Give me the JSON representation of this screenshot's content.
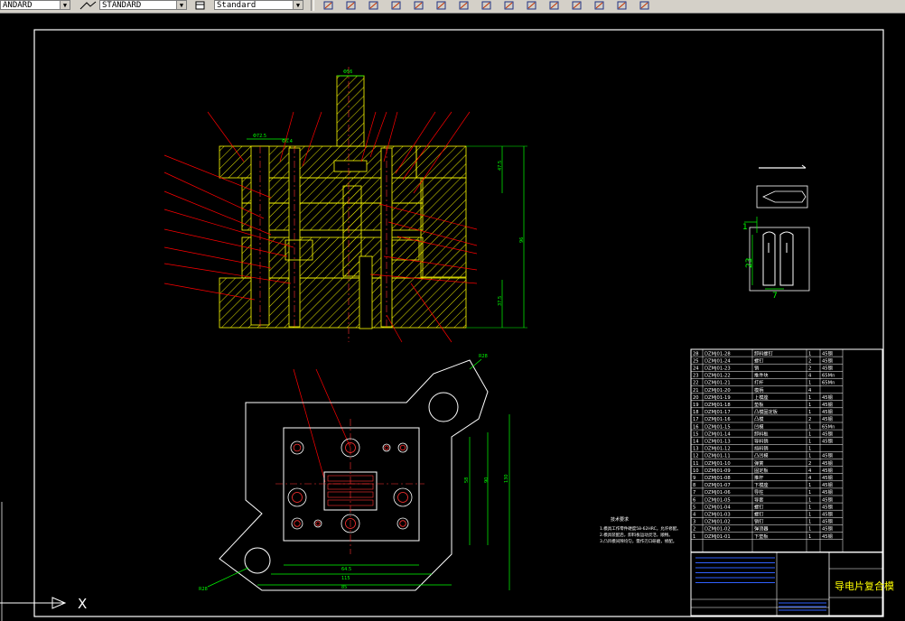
{
  "toolbar": {
    "text_style_combo": "ANDARD",
    "dim_style_combo": "STANDARD",
    "table_style_combo": "Standard",
    "icons": [
      "sketch-icon",
      "move-icon",
      "mirror-icon",
      "offset-icon",
      "array-icon",
      "pan-icon",
      "rotate-icon",
      "scale-icon",
      "stretch-icon",
      "trim-icon",
      "extend-icon",
      "break-icon",
      "chamfer-icon",
      "fillet-icon",
      "explode-icon"
    ]
  },
  "drawing": {
    "title": "导电片复合模",
    "notes_title": "技术要求",
    "notes": [
      "1.模具工作零件硬度58-62HRC，允许修配。",
      "2.模具装配后，卸料板运动灵活，顺畅。",
      "3.凸凹模间隙均匀，需作刃口研磨，修配。"
    ],
    "part_dims": {
      "width": "1",
      "height": "23",
      "pitch": "7"
    },
    "dims": {
      "top_width": "Φ56",
      "left_top": "Φ72.5",
      "left_mid": "Φ6.4",
      "right_total": "96",
      "right_top": "47.5",
      "right_bottom": "37.5",
      "plan_h1": "90",
      "plan_h2": "58",
      "plan_h3": "130",
      "plan_w1": "64.5",
      "plan_w2": "115",
      "plan_w3": "85",
      "hole_label_a": "R28",
      "hole_label_b": "R28"
    },
    "axis_label": "X",
    "bom_rows": [
      [
        "28",
        "DZMJ01-28",
        "卸料螺钉",
        "1",
        "45钢"
      ],
      [
        "25",
        "DZMJ01-24",
        "螺钉",
        "2",
        "45钢"
      ],
      [
        "24",
        "DZMJ01-23",
        "销",
        "2",
        "45钢"
      ],
      [
        "23",
        "DZMJ01-22",
        "推件块",
        "4",
        "65Mn"
      ],
      [
        "22",
        "DZMJ01-21",
        "打杆",
        "1",
        "65Mn"
      ],
      [
        "21",
        "DZMJ01-20",
        "模柄",
        "4",
        ""
      ],
      [
        "20",
        "DZMJ01-19",
        "上模座",
        "1",
        "45钢"
      ],
      [
        "19",
        "DZMJ01-18",
        "垫板",
        "1",
        "45钢"
      ],
      [
        "18",
        "DZMJ01-17",
        "凸模固定板",
        "1",
        "45钢"
      ],
      [
        "17",
        "DZMJ01-16",
        "凸模",
        "2",
        "45钢"
      ],
      [
        "16",
        "DZMJ01-15",
        "凹模",
        "1",
        "65Mn"
      ],
      [
        "15",
        "DZMJ01-14",
        "卸料板",
        "1",
        "45钢"
      ],
      [
        "14",
        "DZMJ01-13",
        "导料销",
        "1",
        "45钢"
      ],
      [
        "13",
        "DZMJ01-12",
        "挡料销",
        "1",
        ""
      ],
      [
        "12",
        "DZMJ01-11",
        "凸凹模",
        "1",
        "45钢"
      ],
      [
        "11",
        "DZMJ01-10",
        "弹簧",
        "2",
        "45钢"
      ],
      [
        "10",
        "DZMJ01-09",
        "固定板",
        "4",
        "45钢"
      ],
      [
        "9",
        "DZMJ01-08",
        "推杆",
        "4",
        "45钢"
      ],
      [
        "8",
        "DZMJ01-07",
        "下模座",
        "1",
        "45钢"
      ],
      [
        "7",
        "DZMJ01-06",
        "导柱",
        "1",
        "45钢"
      ],
      [
        "6",
        "DZMJ01-05",
        "导套",
        "1",
        "45钢"
      ],
      [
        "5",
        "DZMJ01-04",
        "螺钉",
        "1",
        "45钢"
      ],
      [
        "4",
        "DZMJ01-03",
        "螺钉",
        "1",
        "45钢"
      ],
      [
        "3",
        "DZMJ01-02",
        "销钉",
        "1",
        "45钢"
      ],
      [
        "2",
        "DZMJ01-02",
        "弹顶器",
        "1",
        "45钢"
      ],
      [
        "1",
        "DZMJ01-01",
        "下垫板",
        "1",
        "45钢"
      ]
    ]
  },
  "colors": {
    "frame": "#ffffff",
    "leader": "#ff0000",
    "dimension": "#00ff00",
    "part": "#ffff00",
    "hatch": "#ffff00",
    "centerline": "#ff0000",
    "blue": "#3060ff"
  }
}
